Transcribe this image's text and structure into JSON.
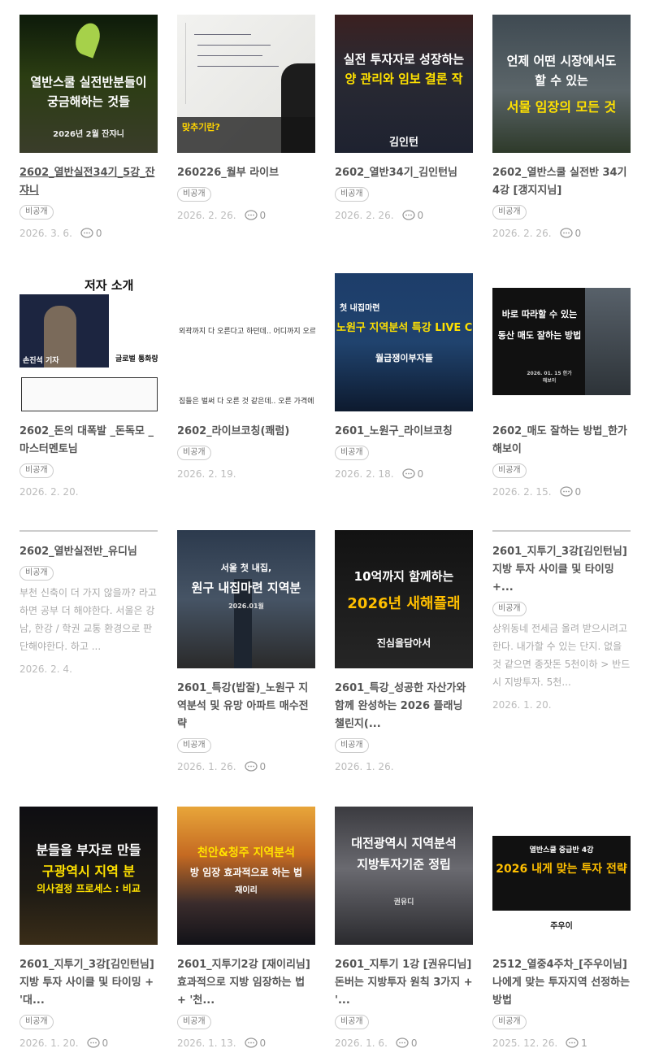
{
  "posts": [
    {
      "title": "2602_열반실전34기_5강_잔쟈니",
      "badge": "비공개",
      "date": "2026. 3. 6.",
      "comments": "0",
      "thumb": {
        "l1": "열반스쿨 실전반분들이",
        "l2": "궁금해하는 것들",
        "l3": "2026년 2월 잔쟈니"
      }
    },
    {
      "title": "260226_월부 라이브",
      "badge": "비공개",
      "date": "2026. 2. 26.",
      "comments": "0",
      "thumb": {
        "l1": "맞추기란?",
        "l2": "",
        "l3": ""
      }
    },
    {
      "title": "2602_열반34기_김인턴님",
      "badge": "비공개",
      "date": "2026. 2. 26.",
      "comments": "0",
      "thumb": {
        "l1": "실전 투자자로 성장하는",
        "l2": "양 관리와 임보 결론 작",
        "l3": "김인턴"
      }
    },
    {
      "title": "2602_열반스쿨 실전반 34기 4강 [갱지지님]",
      "badge": "비공개",
      "date": "2026. 2. 26.",
      "comments": "0",
      "thumb": {
        "l1": "언제 어떤 시장에서도",
        "l2": "할 수 있는",
        "l3": "서물 임장의 모든 것"
      }
    },
    {
      "title": "2602_돈의 대폭발 _돈독모 _마스터멘토님",
      "badge": "비공개",
      "date": "2026. 2. 20.",
      "comments": null,
      "thumb": {
        "l1": "저자 소개",
        "l2": "손진석 기자",
        "l3": "글로벌 통화량 증가"
      }
    },
    {
      "title": "2602_라이브코칭(쾌럼)",
      "badge": "비공개",
      "date": "2026. 2. 19.",
      "comments": null,
      "thumb": {
        "l1": "외곽까지 다 오른다고 하던데.. 어디까지 오르는 것인가",
        "l2": "집들은 벌써 다 오른 것 같은데.. 오른 가격에 사도 되는건가",
        "l3": ""
      }
    },
    {
      "title": "2601_노원구_라이브코칭",
      "badge": "비공개",
      "date": "2026. 2. 18.",
      "comments": "0",
      "thumb": {
        "l1": "첫 내집마련",
        "l2": "노원구 지역분석 특강 LIVE COACHING",
        "l3": "월급쟁이부자들"
      }
    },
    {
      "title": "2602_매도 잘하는 방법_한가해보이",
      "badge": "비공개",
      "date": "2026. 2. 15.",
      "comments": "0",
      "thumb": {
        "l1": "바로 따라할 수 있는",
        "l2": "동산 매도 잘하는 방법",
        "l3": "2026. 01. 15 한가해보이"
      }
    },
    {
      "title": "2602_열반실전반_유디님",
      "badge": "비공개",
      "date": "2026. 2. 4.",
      "comments": null,
      "excerpt": "부천 신축이 더 가지 않을까? 라고 하면 공부 더 해야한다. 서울은 강남, 한강 / 학권 교통 환경으로 판단해야한다. 하고 ..."
    },
    {
      "title": "2601_특강(밥잘)_노원구 지역분석 및 유망 아파트 매수전략",
      "badge": "비공개",
      "date": "2026. 1. 26.",
      "comments": "0",
      "thumb": {
        "l1": "서울 첫 내집,",
        "l2": "원구 내집마련 지역분",
        "l3": "2026.01월"
      }
    },
    {
      "title": "2601_특강_성공한 자산가와 함께 완성하는 2026 플래닝 챌린지(...",
      "badge": "비공개",
      "date": "2026. 1. 26.",
      "comments": null,
      "thumb": {
        "l1": "10억까지 함께하는",
        "l2": "2026년 새해플래",
        "l3": "진심을담아서"
      }
    },
    {
      "title": "2601_지투기_3강[김인턴님] 지방 투자 사이클 및 타이밍 +...",
      "badge": "비공개",
      "date": "2026. 1. 20.",
      "comments": null,
      "excerpt": "상위동네 전세금 올려 받으시려고 한다. 내가할 수 있는 단지. 없을것 같으면 종잣돈 5천이하 > 반드시 지방투자. 5천..."
    },
    {
      "title": "2601_지투기_3강[김인턴님] 지방 투자 사이클 및 타이밍 + '대...",
      "badge": "비공개",
      "date": "2026. 1. 20.",
      "comments": "0",
      "thumb": {
        "l1": "분들을 부자로 만들",
        "l2": "구광역시 지역 분",
        "l3": "의사결정 프로세스 : 비교"
      }
    },
    {
      "title": "2601_지투기2강 [재이리님] 효과적으로 지방 임장하는 법 + '천...",
      "badge": "비공개",
      "date": "2026. 1. 13.",
      "comments": "0",
      "thumb": {
        "l1": "천안&청주 지역분석",
        "l2": "방 임장 효과적으로 하는 법",
        "l3": "재이리"
      }
    },
    {
      "title": "2601_지투기 1강 [권유디님] 돈버는 지방투자 원칙 3가지 + '...",
      "badge": "비공개",
      "date": "2026. 1. 6.",
      "comments": "0",
      "thumb": {
        "l1": "대전광역시 지역분석",
        "l2": "지방투자기준 정립",
        "l3": "권유디"
      }
    },
    {
      "title": "2512_열중4주차_[주우이님] 나에게 맞는 투자지역 선정하는 방법",
      "badge": "비공개",
      "date": "2025. 12. 26.",
      "comments": "1",
      "thumb": {
        "l1": "열반스쿨 중급반 4강",
        "l2": "2026 내게 맞는 투자 전략",
        "l3": "주우이"
      }
    }
  ]
}
